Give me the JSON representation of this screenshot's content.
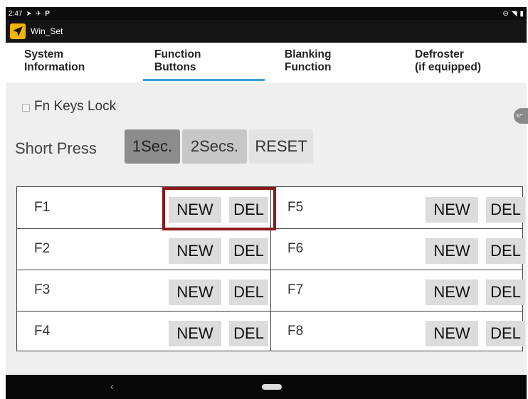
{
  "status_bar": {
    "time": "2:47",
    "left_icons": [
      "navigation-icon",
      "airplane-icon",
      "parking-icon"
    ],
    "right_icons": [
      "minus-circle-icon",
      "wifi-icon",
      "battery-icon"
    ]
  },
  "app": {
    "title": "Win_Set",
    "icon": "navigation-arrow-icon"
  },
  "tabs": [
    {
      "line1": "System",
      "line2": "Information",
      "active": false
    },
    {
      "line1": "Function",
      "line2": "Buttons",
      "active": true
    },
    {
      "line1": "Blanking",
      "line2": "Function",
      "active": false
    },
    {
      "line1": "Defroster",
      "line2": "(if equipped)",
      "active": false
    }
  ],
  "fn_lock": {
    "label": "Fn Keys Lock",
    "checked": false
  },
  "short_press": {
    "label": "Short Press",
    "options": [
      "1Sec.",
      "2Secs.",
      "RESET"
    ],
    "selected": "1Sec."
  },
  "keys": [
    {
      "label": "F1",
      "new": "NEW",
      "del": "DEL"
    },
    {
      "label": "F2",
      "new": "NEW",
      "del": "DEL"
    },
    {
      "label": "F3",
      "new": "NEW",
      "del": "DEL"
    },
    {
      "label": "F4",
      "new": "NEW",
      "del": "DEL"
    },
    {
      "label": "F5",
      "new": "NEW",
      "del": "DEL"
    },
    {
      "label": "F6",
      "new": "NEW",
      "del": "DEL"
    },
    {
      "label": "F7",
      "new": "NEW",
      "del": "DEL"
    },
    {
      "label": "F8",
      "new": "NEW",
      "del": "DEL"
    }
  ],
  "scroll_indicator": "37°",
  "colors": {
    "accent": "#3c9fd8",
    "highlight": "#8b1a1a",
    "app_icon": "#f5b400"
  }
}
